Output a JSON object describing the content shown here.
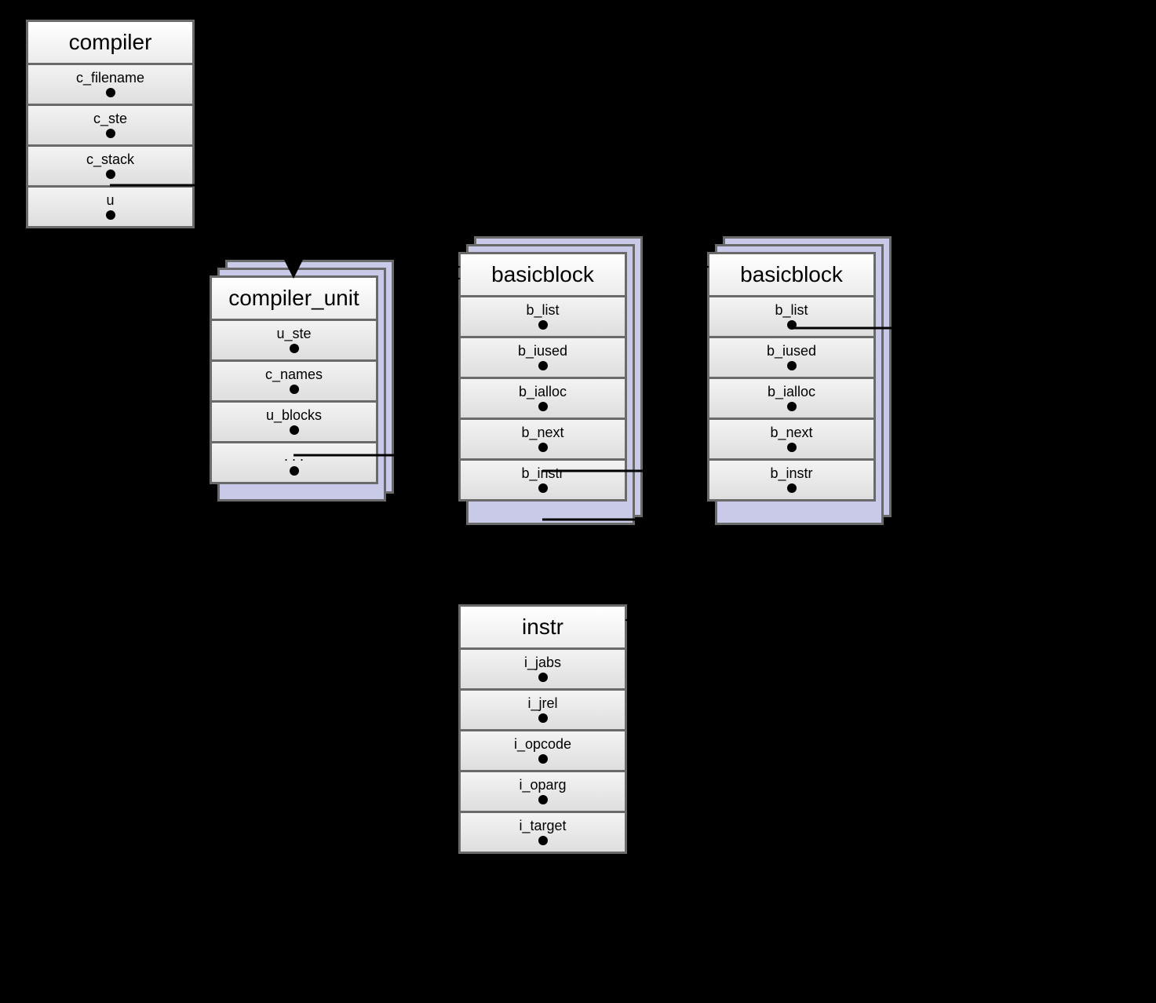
{
  "structs": {
    "compiler": {
      "title": "compiler",
      "fields": [
        "c_filename",
        "c_ste",
        "c_stack",
        "u"
      ]
    },
    "compiler_unit": {
      "title": "compiler_unit",
      "fields": [
        "u_ste",
        "c_names",
        "u_blocks",
        ". . ."
      ]
    },
    "basicblock1": {
      "title": "basicblock",
      "fields": [
        "b_list",
        "b_iused",
        "b_ialloc",
        "b_next",
        "b_instr"
      ]
    },
    "basicblock2": {
      "title": "basicblock",
      "fields": [
        "b_list",
        "b_iused",
        "b_ialloc",
        "b_next",
        "b_instr"
      ]
    },
    "instr": {
      "title": "instr",
      "fields": [
        "i_jabs",
        "i_jrel",
        "i_opcode",
        "i_oparg",
        "i_target"
      ]
    }
  }
}
